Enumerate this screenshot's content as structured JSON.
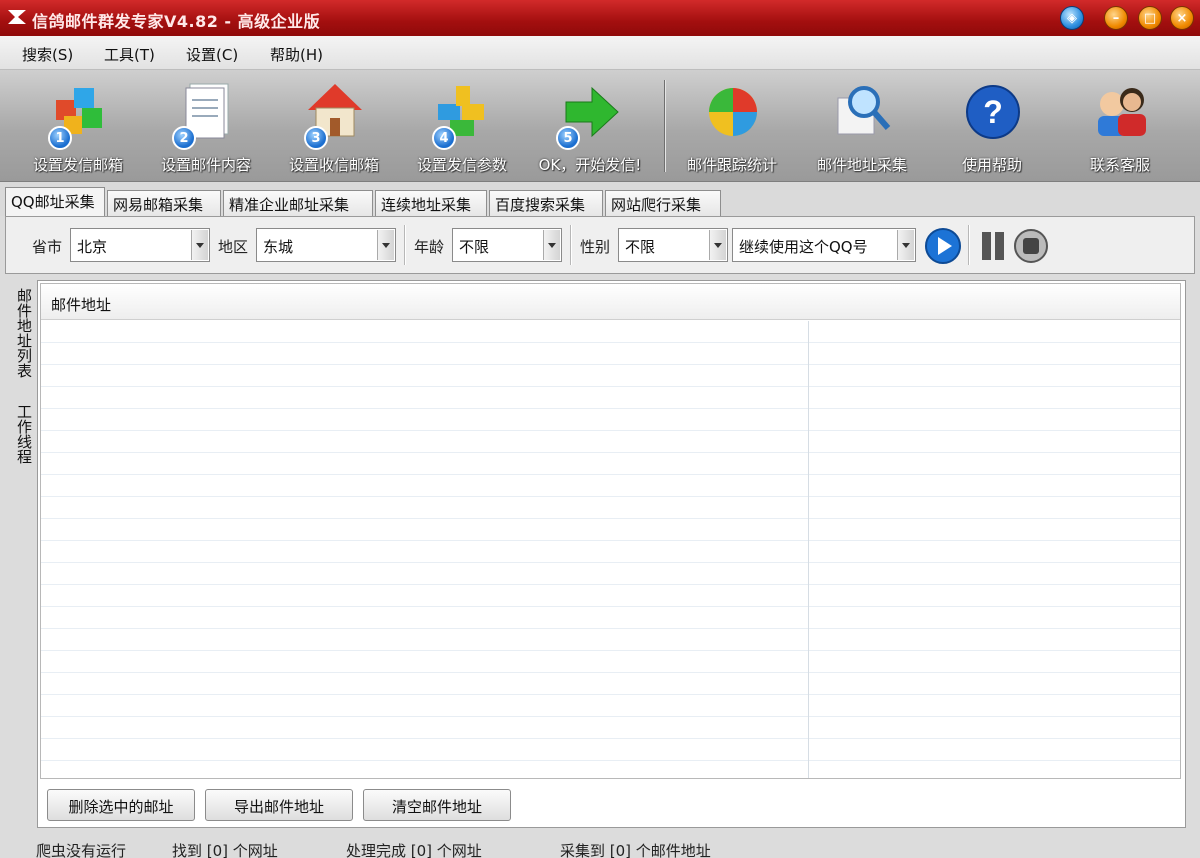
{
  "window": {
    "title": "信鸽邮件群发专家V4.82 - 高级企业版"
  },
  "menu": [
    "搜索(S)",
    "工具(T)",
    "设置(C)",
    "帮助(H)"
  ],
  "toolbar": {
    "items": [
      {
        "label": "设置发信邮箱",
        "icon": "mailbox-cubes-icon",
        "step": "1"
      },
      {
        "label": "设置邮件内容",
        "icon": "document-icon",
        "step": "2"
      },
      {
        "label": "设置收信邮箱",
        "icon": "house-icon",
        "step": "3"
      },
      {
        "label": "设置发信参数",
        "icon": "puzzle-icon",
        "step": "4"
      },
      {
        "label": "OK，开始发信!",
        "icon": "green-arrow-icon",
        "step": "5"
      },
      {
        "label": "邮件跟踪统计",
        "icon": "pie-chart-icon"
      },
      {
        "label": "邮件地址采集",
        "icon": "magnifier-icon"
      },
      {
        "label": "使用帮助",
        "icon": "help-icon"
      },
      {
        "label": "联系客服",
        "icon": "customer-service-icon"
      }
    ]
  },
  "tabs": [
    "QQ邮址采集",
    "网易邮箱采集",
    "精准企业邮址采集",
    "连续地址采集",
    "百度搜索采集",
    "网站爬行采集"
  ],
  "filters": {
    "province_label": "省市",
    "province_value": "北京",
    "district_label": "地区",
    "district_value": "东城",
    "age_label": "年龄",
    "age_value": "不限",
    "gender_label": "性别",
    "gender_value": "不限",
    "qq_option": "继续使用这个QQ号"
  },
  "side_tabs": [
    "邮件地址列表",
    "工作线程"
  ],
  "grid": {
    "header": "邮件地址"
  },
  "buttons": {
    "delete": "删除选中的邮址",
    "export": "导出邮件地址",
    "clear": "清空邮件地址"
  },
  "status": {
    "crawler": "爬虫没有运行",
    "found": "找到 [0] 个网址",
    "processed": "处理完成 [0] 个网址",
    "collected": "采集到 [0] 个邮件地址"
  },
  "colors": {
    "title_bar": "#b01616",
    "toolbar_bg": "#a8a8a8"
  }
}
